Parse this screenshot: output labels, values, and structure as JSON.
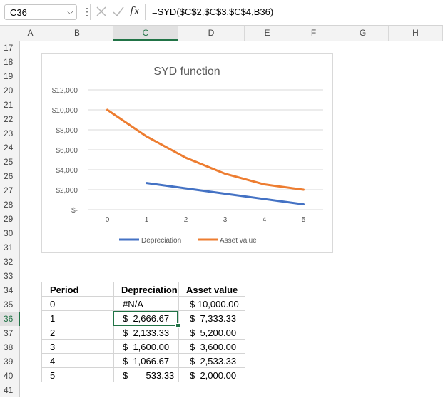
{
  "formula_bar": {
    "name_box": "C36",
    "formula": "=SYD($C$2,$C$3,$C$4,B36)",
    "fx_label": "fx"
  },
  "columns": [
    "A",
    "B",
    "C",
    "D",
    "E",
    "F",
    "G",
    "H"
  ],
  "selected_column": "C",
  "rows": [
    "17",
    "18",
    "19",
    "20",
    "21",
    "22",
    "23",
    "24",
    "25",
    "26",
    "27",
    "28",
    "29",
    "30",
    "31",
    "32",
    "33",
    "34",
    "35",
    "36",
    "37",
    "38",
    "39",
    "40",
    "41"
  ],
  "selected_row": "36",
  "table": {
    "headers": [
      "Period",
      "Depreciation",
      "Asset value"
    ],
    "rows": [
      {
        "period": "0",
        "dep": "#N/A",
        "asset": "$ 10,000.00"
      },
      {
        "period": "1",
        "dep": "$  2,666.67",
        "asset": "$  7,333.33"
      },
      {
        "period": "2",
        "dep": "$  2,133.33",
        "asset": "$  5,200.00"
      },
      {
        "period": "3",
        "dep": "$  1,600.00",
        "asset": "$  3,600.00"
      },
      {
        "period": "4",
        "dep": "$  1,066.67",
        "asset": "$  2,533.33"
      },
      {
        "period": "5",
        "dep": "$       533.33",
        "asset": "$  2,000.00"
      }
    ]
  },
  "chart_data": {
    "type": "line",
    "title": "SYD function",
    "x": [
      0,
      1,
      2,
      3,
      4,
      5
    ],
    "ylim": [
      0,
      12000
    ],
    "yticks": [
      "$-",
      "$2,000",
      "$4,000",
      "$6,000",
      "$8,000",
      "$10,000",
      "$12,000"
    ],
    "ytick_values": [
      0,
      2000,
      4000,
      6000,
      8000,
      10000,
      12000
    ],
    "grid": true,
    "legend_position": "bottom",
    "series": [
      {
        "name": "Depreciation",
        "color": "#4472C4",
        "values": [
          null,
          2666.67,
          2133.33,
          1600.0,
          1066.67,
          533.33
        ]
      },
      {
        "name": "Asset value",
        "color": "#ED7D31",
        "values": [
          10000.0,
          7333.33,
          5200.0,
          3600.0,
          2533.33,
          2000.0
        ]
      }
    ]
  },
  "colors": {
    "excel_green": "#217346"
  }
}
